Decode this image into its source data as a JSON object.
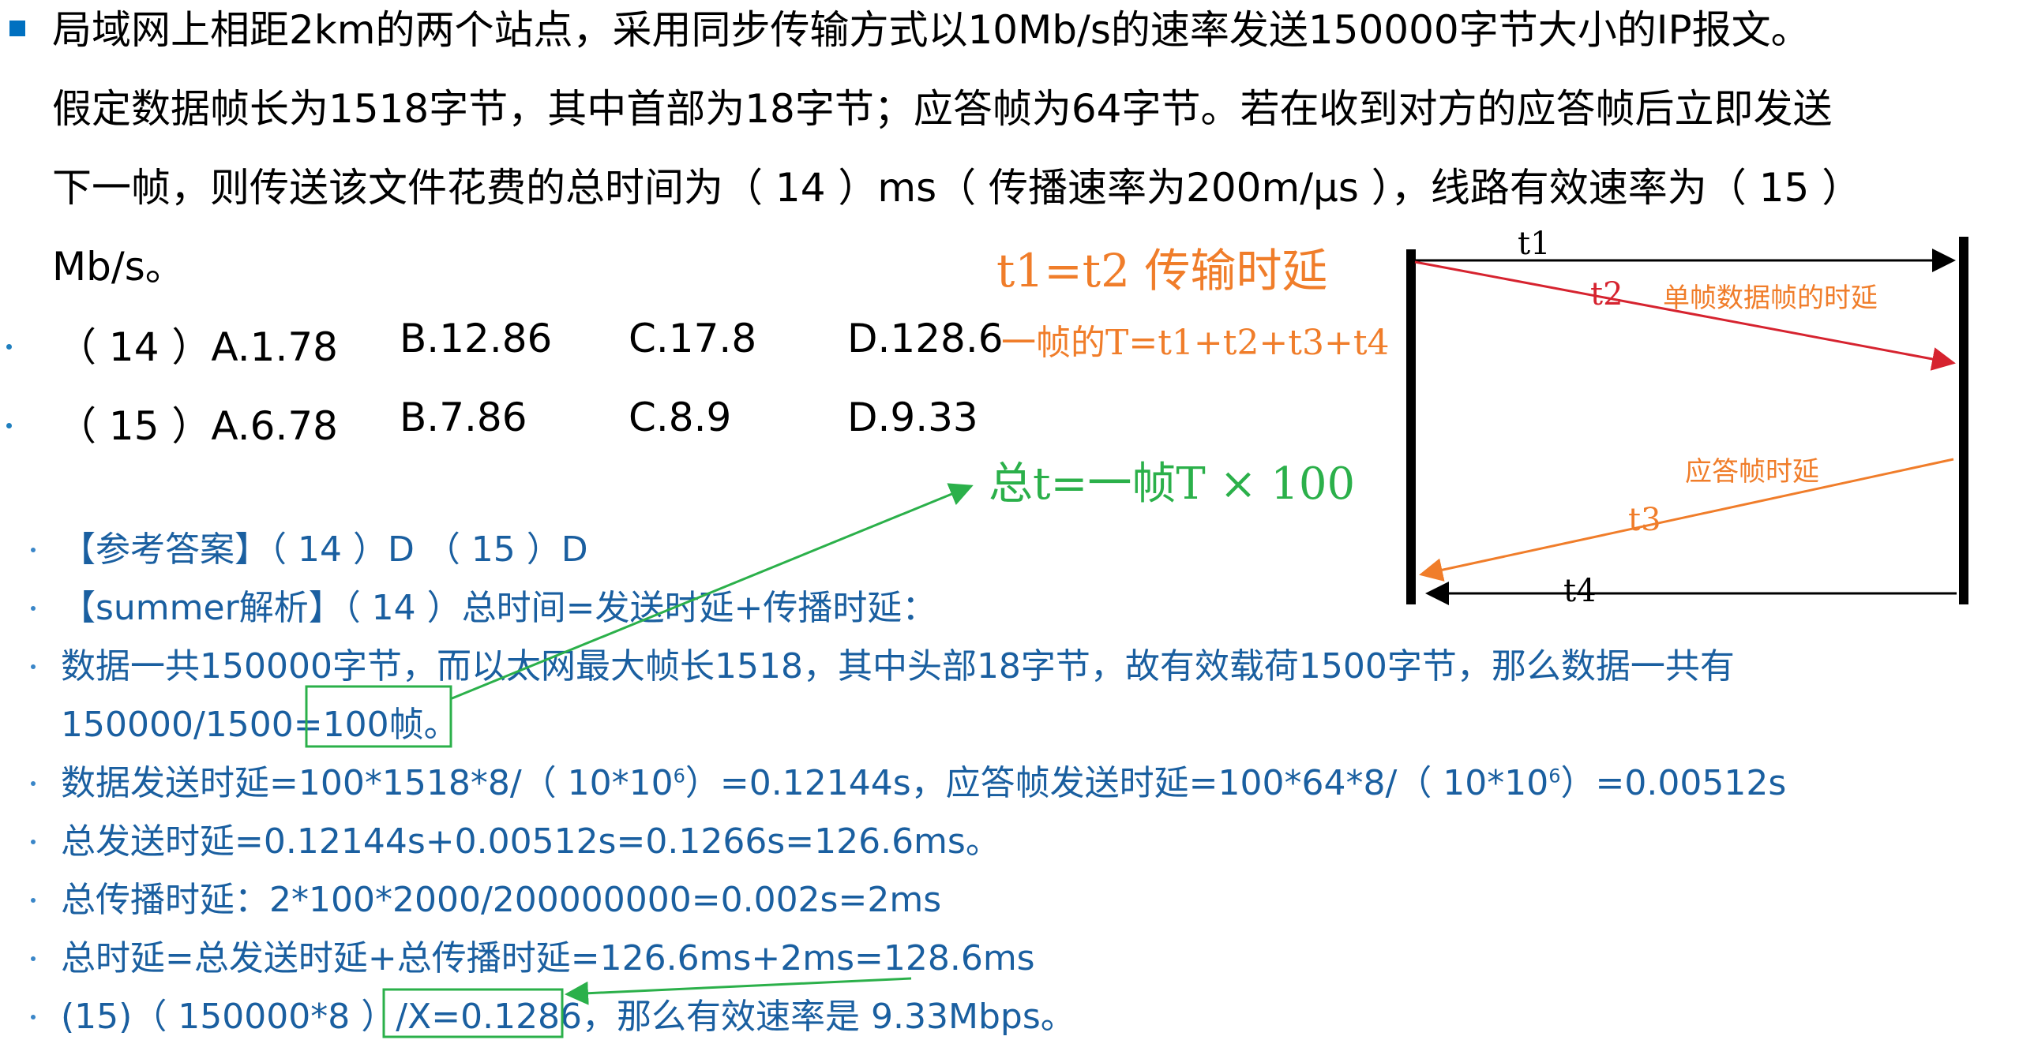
{
  "question": {
    "line1": "局域网上相距2km的两个站点，采用同步传输方式以10Mb/s的速率发送150000字节大小的IP报文。",
    "line2": "假定数据帧长为1518字节，其中首部为18字节；应答帧为64字节。若在收到对方的应答帧后立即发送",
    "line3": "下一帧，则传送该文件花费的总时间为（ 14 ）ms（ 传播速率为200m/μs ），线路有效速率为（ 15 ）",
    "line4": "Mb/s。"
  },
  "options_14": {
    "label": "（ 14 ）A.1.78",
    "b": "B.12.86",
    "c": "C.17.8",
    "d": "D.128.6"
  },
  "options_15": {
    "label": "（ 15 ）A.6.78",
    "b": "B.7.86",
    "c": "C.8.9",
    "d": "D.9.33"
  },
  "annotations": {
    "t1_eq_t2": "t1=t2  传输时延",
    "frame_T": "一帧的T=t1+t2+t3+t4",
    "total_t": "总t=一帧T × 100"
  },
  "diagram": {
    "t1": "t1",
    "t2": "t2",
    "t3": "t3",
    "t4": "t4",
    "frame_delay": "单帧数据帧的时延",
    "ack_delay": "应答帧时延"
  },
  "solution": {
    "answer": "【参考答案】（ 14 ）D  （ 15 ）D",
    "analysis": "【summer解析】（ 14 ）总时间=发送时延+传播时延：",
    "data_line1": "数据一共150000字节，而以太网最大帧长1518，其中头部18字节，故有效载荷1500字节，那么数据一共有",
    "data_line2a": "150000/1500=",
    "data_line2b": "100帧。",
    "send_delay_a": "数据发送时延=100*1518*8/（ 10*10",
    "exp1": "6",
    "send_delay_b": "）=0.12144s，应答帧发送时延=100*64*8/（ 10*10",
    "exp2": "6",
    "send_delay_c": "）=0.00512s",
    "total_send": "总发送时延=0.12144s+0.00512s=0.1266s=126.6ms。",
    "total_prop": "总传播时延：2*100*2000/200000000=0.002s=2ms",
    "total_delay": "总时延=总发送时延+总传播时延=126.6ms+2ms=128.6ms",
    "rate_a": "(15)（ 150000*8 ）/",
    "rate_b": "X=0.1286",
    "rate_c": "，那么有效速率是 9.33Mbps。"
  },
  "colors": {
    "question_text": "#000000",
    "solution_text": "#1a5fa0",
    "orange": "#f07d2a",
    "green": "#2bb04a",
    "red": "#d6232f",
    "accent_bullet": "#0070c0"
  }
}
